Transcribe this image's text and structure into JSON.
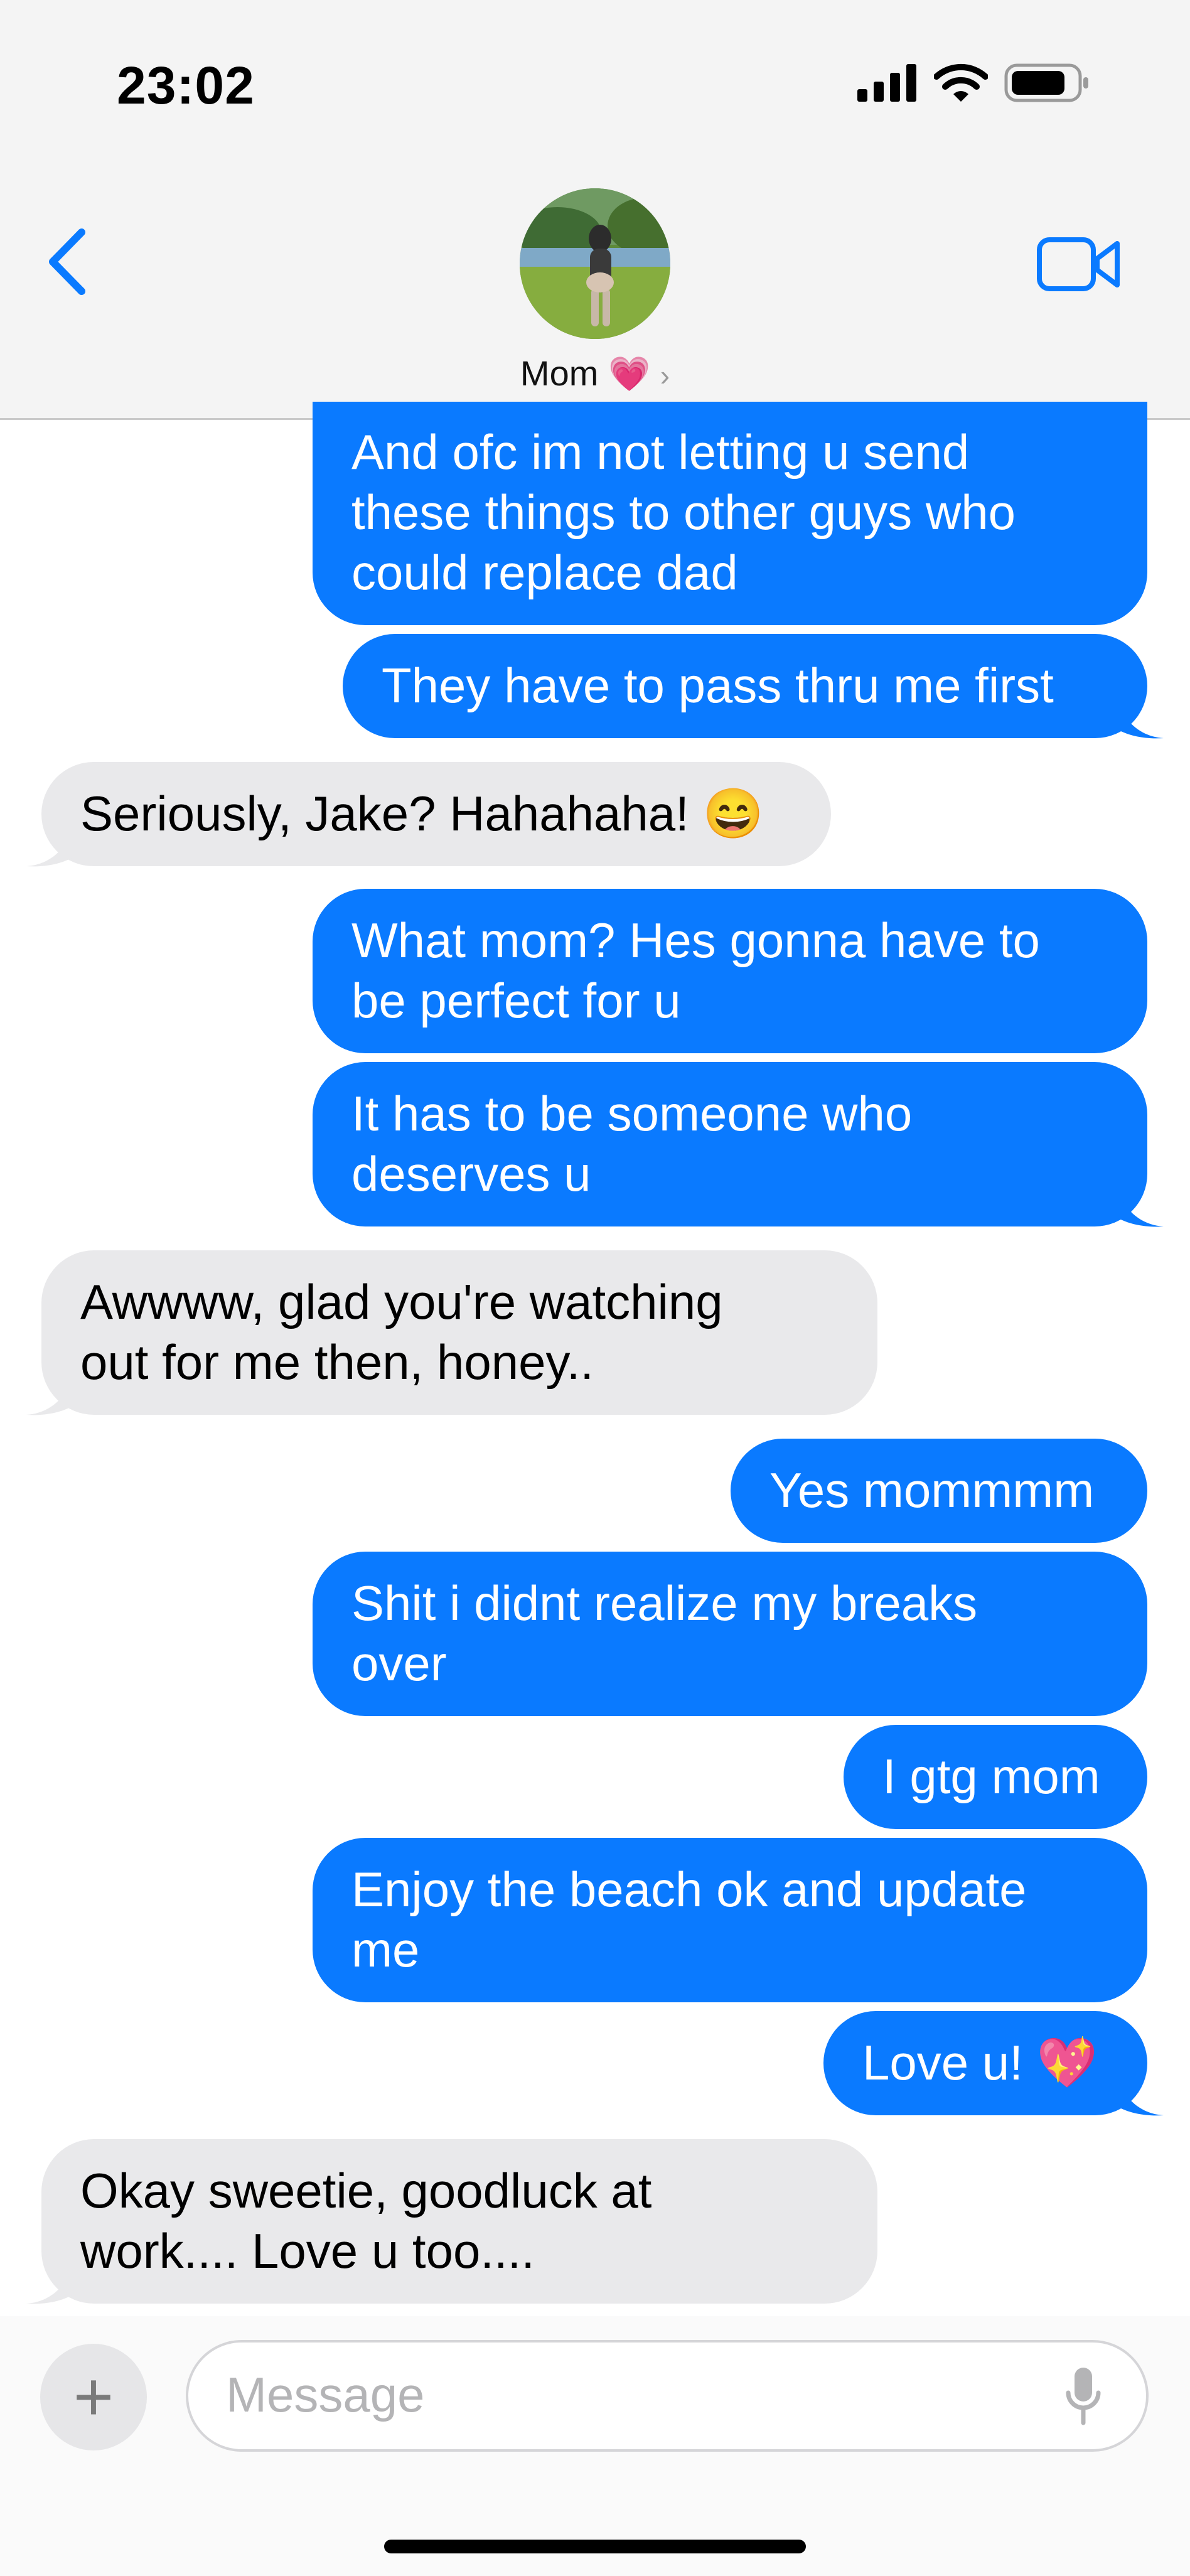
{
  "status_bar": {
    "time": "23:02"
  },
  "header": {
    "contact_name": "Mom",
    "name_emoji": "💗",
    "chevron": "›",
    "icons": [
      "back-chevron-icon",
      "video-camera-icon"
    ]
  },
  "accent_color": "#0a7aff",
  "messages": [
    {
      "from": "me",
      "lines": [
        "And ofc im not letting u send",
        "these things to other guys who",
        "could replace dad"
      ]
    },
    {
      "from": "me",
      "lines": [
        "They have to pass thru me first"
      ]
    },
    {
      "from": "mom",
      "lines": [
        "Seriously, Jake? Hahahaha! 😄"
      ]
    },
    {
      "from": "me",
      "lines": [
        "What mom? Hes gonna have to",
        "be perfect for u"
      ]
    },
    {
      "from": "me",
      "lines": [
        "It has to be someone who",
        "deserves u"
      ]
    },
    {
      "from": "mom",
      "lines": [
        "Awwww, glad you're watching",
        "out for me then, honey.."
      ]
    },
    {
      "from": "me",
      "lines": [
        "Yes mommmm"
      ]
    },
    {
      "from": "me",
      "lines": [
        "Shit i didnt realize my breaks",
        "over"
      ]
    },
    {
      "from": "me",
      "lines": [
        "I gtg mom"
      ]
    },
    {
      "from": "me",
      "lines": [
        "Enjoy the beach ok and update",
        "me"
      ]
    },
    {
      "from": "me",
      "lines": [
        "Love u! 💖"
      ]
    },
    {
      "from": "mom",
      "lines": [
        "Okay sweetie, goodluck at",
        "work.... Love u too...."
      ]
    }
  ],
  "input": {
    "placeholder": "Message",
    "plus": "+"
  }
}
